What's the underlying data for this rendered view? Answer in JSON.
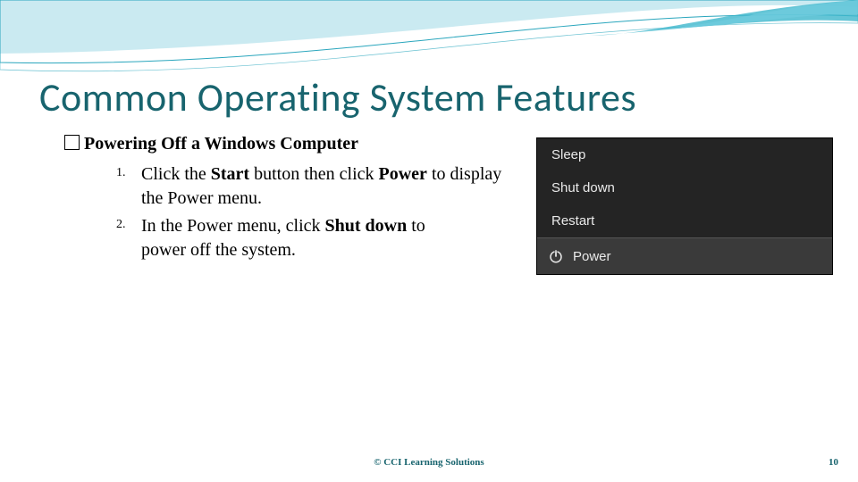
{
  "title": "Common Operating System Features",
  "subtitle": "Powering Off a Windows Computer",
  "steps": {
    "s1_a": "Click the ",
    "s1_b": "Start",
    "s1_c": " button then click ",
    "s1_d": "Power",
    "s1_e": " to display the Power menu.",
    "s2_a": "In the Power menu, click ",
    "s2_b": "Shut down",
    "s2_c": " to",
    "s2_d": "power off the system."
  },
  "menu": {
    "sleep": "Sleep",
    "shutdown": "Shut down",
    "restart": "Restart",
    "power": "Power"
  },
  "footer": "© CCI Learning Solutions",
  "page": "10"
}
